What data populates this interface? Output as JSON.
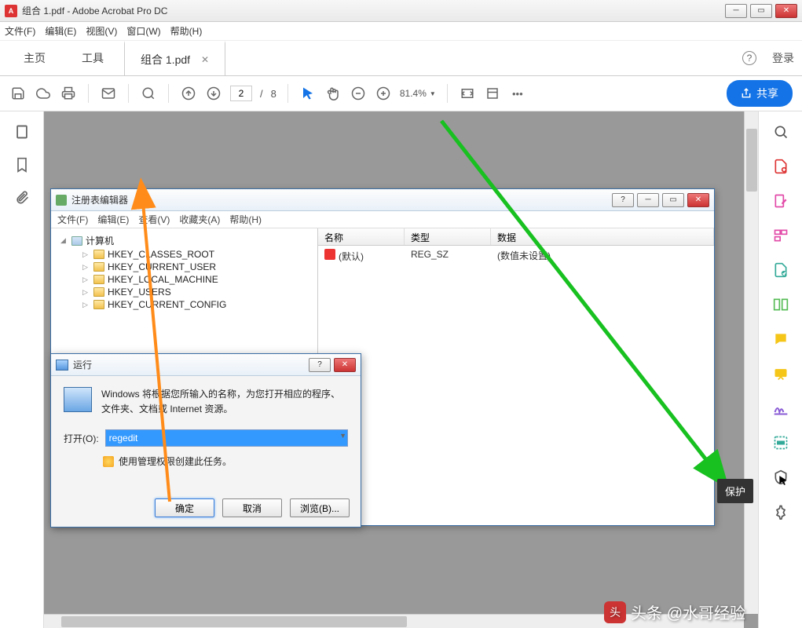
{
  "titlebar": {
    "title": "组合 1.pdf - Adobe Acrobat Pro DC"
  },
  "menubar": {
    "file": "文件(F)",
    "edit": "编辑(E)",
    "view": "视图(V)",
    "window": "窗口(W)",
    "help": "帮助(H)"
  },
  "tabs": {
    "home": "主页",
    "tools": "工具",
    "doc": "组合 1.pdf",
    "signin": "登录"
  },
  "toolbar": {
    "page_current": "2",
    "page_sep": "/",
    "page_total": "8",
    "zoom": "81.4%",
    "share": "共享"
  },
  "regedit": {
    "title": "注册表编辑器",
    "menu": {
      "file": "文件(F)",
      "edit": "编辑(E)",
      "view": "查看(V)",
      "fav": "收藏夹(A)",
      "help": "帮助(H)"
    },
    "tree": {
      "root": "计算机",
      "keys": [
        "HKEY_CLASSES_ROOT",
        "HKEY_CURRENT_USER",
        "HKEY_LOCAL_MACHINE",
        "HKEY_USERS",
        "HKEY_CURRENT_CONFIG"
      ]
    },
    "list": {
      "col_name": "名称",
      "col_type": "类型",
      "col_data": "数据",
      "row_name": "(默认)",
      "row_type": "REG_SZ",
      "row_data": "(数值未设置)"
    }
  },
  "run": {
    "title": "运行",
    "desc": "Windows 将根据您所输入的名称，为您打开相应的程序、文件夹、文档或 Internet 资源。",
    "open_label": "打开(O):",
    "value": "regedit",
    "admin_note": "使用管理权限创建此任务。",
    "ok": "确定",
    "cancel": "取消",
    "browse": "浏览(B)..."
  },
  "tooltip": {
    "protect": "保护"
  },
  "watermark": {
    "text": "头条 @水哥经验"
  }
}
